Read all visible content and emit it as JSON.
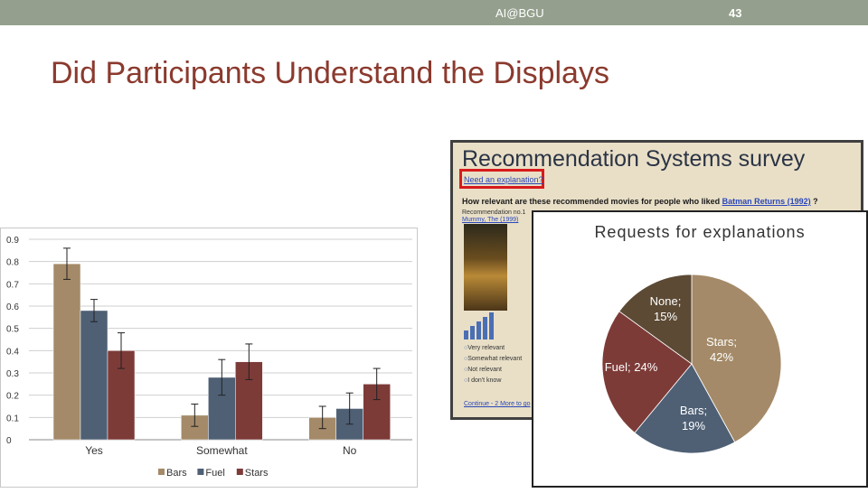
{
  "header": {
    "org": "AI@BGU",
    "slide_number": "43"
  },
  "slide_title": "Did Participants Understand the Displays",
  "survey": {
    "title": "Recommendation Systems survey",
    "need_explanation": "Need an explanation?",
    "question_prefix": "How relevant are these recommended movies for people who liked",
    "question_movie": "Batman Returns (1992)",
    "question_suffix": "?",
    "rec_label": "Recommendation no.1",
    "movie": "Mummy, The (1999)",
    "options": [
      "Very relevant",
      "Somewhat relevant",
      "Not relevant",
      "I don't know"
    ],
    "continue": "Continue - 2 More to go"
  },
  "chart_data": [
    {
      "type": "bar",
      "categories": [
        "Yes",
        "Somewhat",
        "No"
      ],
      "series": [
        {
          "name": "Bars",
          "values": [
            0.79,
            0.11,
            0.1
          ],
          "errors": [
            0.07,
            0.05,
            0.05
          ],
          "color": "#a48a68"
        },
        {
          "name": "Fuel",
          "values": [
            0.58,
            0.28,
            0.14
          ],
          "errors": [
            0.05,
            0.08,
            0.07
          ],
          "color": "#4f6075"
        },
        {
          "name": "Stars",
          "values": [
            0.4,
            0.35,
            0.25
          ],
          "errors": [
            0.08,
            0.08,
            0.07
          ],
          "color": "#7d3b38"
        }
      ],
      "yticks": [
        "0",
        "0.1",
        "0.2",
        "0.3",
        "0.4",
        "0.5",
        "0.6",
        "0.7",
        "0.8",
        "0.9"
      ],
      "ylim": [
        0,
        0.9
      ],
      "grid": true,
      "legend": "bottom"
    },
    {
      "type": "pie",
      "title": "Requests for explanations",
      "slices": [
        {
          "label": "Stars",
          "value": 42,
          "text": "Stars; 42%",
          "color": "#a48a68"
        },
        {
          "label": "Bars",
          "value": 19,
          "text": "Bars; 19%",
          "color": "#4f6075"
        },
        {
          "label": "Fuel",
          "value": 24,
          "text": "Fuel; 24%",
          "color": "#7d3b38"
        },
        {
          "label": "None",
          "value": 15,
          "text": "None; 15%",
          "color": "#5c4a35"
        }
      ]
    }
  ]
}
